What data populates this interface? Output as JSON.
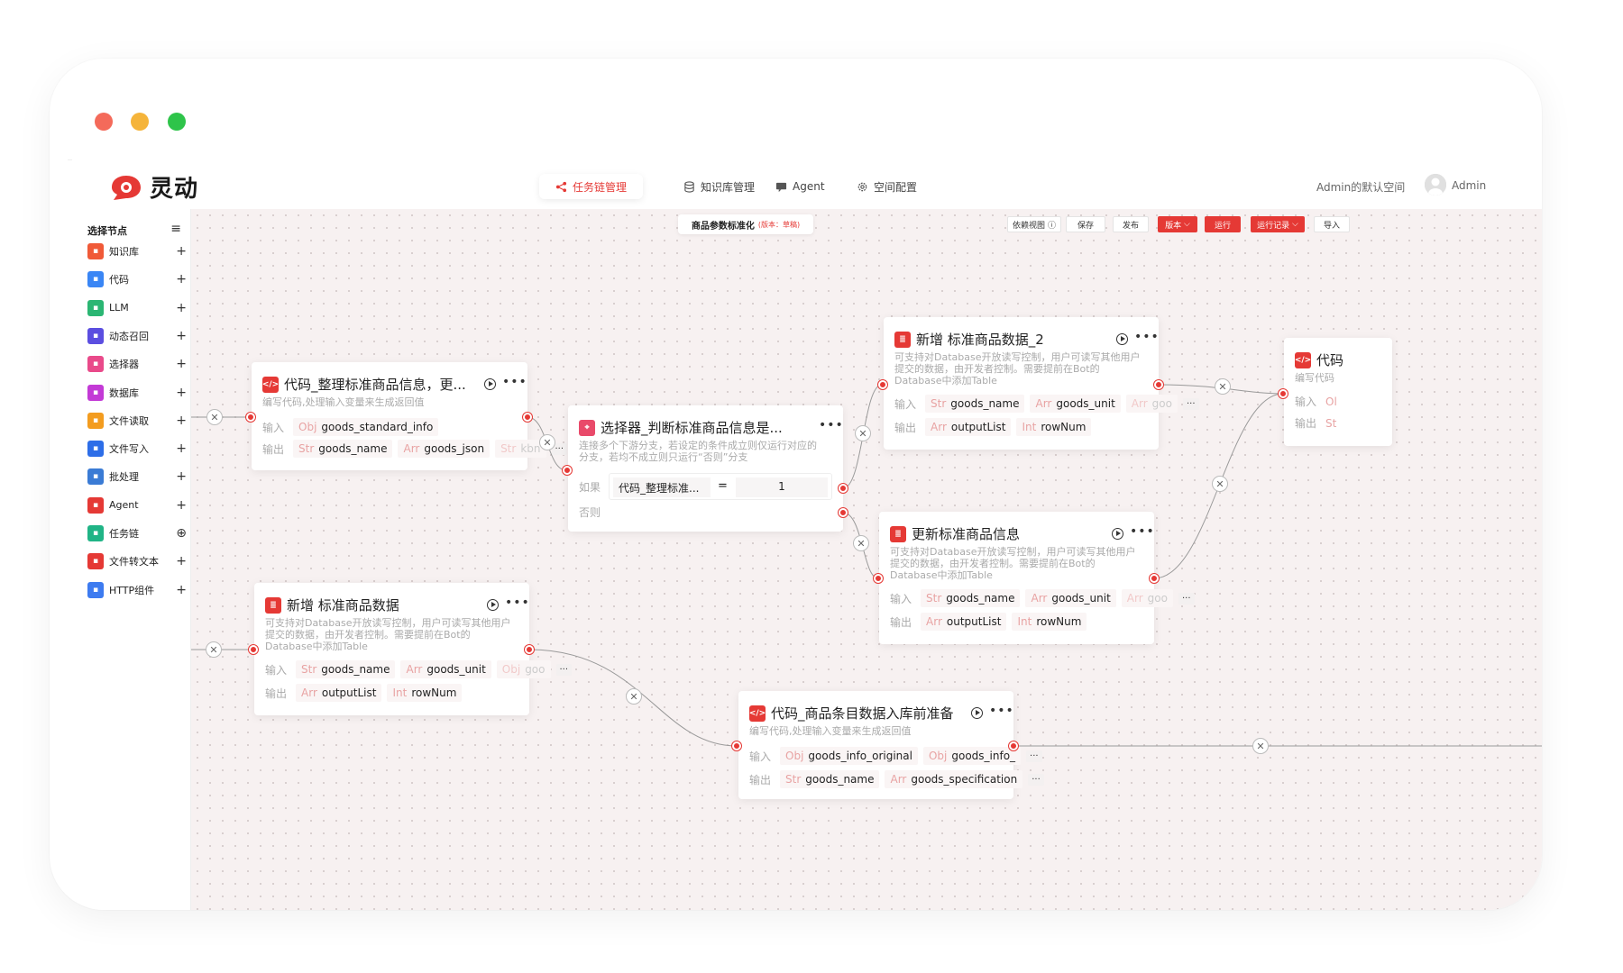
{
  "app": {
    "logo_text": "灵动",
    "nav": [
      {
        "label": "任务链管理",
        "active": true
      },
      {
        "label": "知识库管理",
        "active": false
      },
      {
        "label": "Agent",
        "active": false
      },
      {
        "label": "空间配置",
        "active": false
      }
    ],
    "workspace": "Admin的默认空间",
    "user": "Admin"
  },
  "sidebar": {
    "title": "选择节点",
    "items": [
      {
        "label": "知识库",
        "icon": "book-icon",
        "color": "#f05a38",
        "action": "+"
      },
      {
        "label": "代码",
        "icon": "code-icon",
        "color": "#3a86f5",
        "action": "+"
      },
      {
        "label": "LLM",
        "icon": "llm-icon",
        "color": "#2bb673",
        "action": "+"
      },
      {
        "label": "动态召回",
        "icon": "recall-icon",
        "color": "#5b4ee0",
        "action": "+"
      },
      {
        "label": "选择器",
        "icon": "selector-icon",
        "color": "#e94a8a",
        "action": "+"
      },
      {
        "label": "数据库",
        "icon": "database-icon",
        "color": "#c33ad6",
        "action": "+"
      },
      {
        "label": "文件读取",
        "icon": "file-read-icon",
        "color": "#f39c1f",
        "action": "+"
      },
      {
        "label": "文件写入",
        "icon": "file-write-icon",
        "color": "#2d6ee8",
        "action": "+"
      },
      {
        "label": "批处理",
        "icon": "batch-icon",
        "color": "#3a7bd5",
        "action": "+"
      },
      {
        "label": "Agent",
        "icon": "agent-icon",
        "color": "#e53935",
        "action": "+"
      },
      {
        "label": "任务链",
        "icon": "chain-icon",
        "color": "#20b486",
        "action": "⊕"
      },
      {
        "label": "文件转文本",
        "icon": "file-text-icon",
        "color": "#e53935",
        "action": "+"
      },
      {
        "label": "HTTP组件",
        "icon": "http-icon",
        "color": "#3d7bf0",
        "action": "+"
      }
    ]
  },
  "toolbar": {
    "flow_name": "商品参数标准化",
    "flow_version": "(版本：草稿)",
    "buttons": [
      "依赖视图",
      "保存",
      "发布",
      "版本",
      "运行",
      "运行记录",
      "导入"
    ]
  },
  "nodes": {
    "code1": {
      "title": "代码_整理标准商品信息，更...",
      "desc": [
        "编写代码,处理输入变量来生成返回值"
      ],
      "input_label": "输入",
      "inputs": [
        {
          "type": "Obj",
          "name": "goods_standard_info"
        }
      ],
      "output_label": "输出",
      "outputs": [
        {
          "type": "Str",
          "name": "goods_name"
        },
        {
          "type": "Arr",
          "name": "goods_json"
        },
        {
          "type": "Str",
          "name": "kbn"
        }
      ]
    },
    "selector": {
      "title": "选择器_判断标准商品信息是...",
      "desc": [
        "连接多个下游分支，若设定的条件成立则仅运行对应的",
        "分支，若均不成立则只运行“否则”分支"
      ],
      "if_label": "如果",
      "cond_left": "代码_整理标准...",
      "cond_op": "=",
      "cond_right": "1",
      "else_label": "否则"
    },
    "insert1": {
      "title": "新增 标准商品数据",
      "desc": [
        "可支持对Database开放读写控制，用户可读写其他用户",
        "提交的数据，由开发者控制。需要提前在Bot的",
        "Database中添加Table"
      ],
      "input_label": "输入",
      "inputs": [
        {
          "type": "Str",
          "name": "goods_name"
        },
        {
          "type": "Arr",
          "name": "goods_unit"
        },
        {
          "type": "Obj",
          "name": "goo"
        }
      ],
      "output_label": "输出",
      "outputs": [
        {
          "type": "Arr",
          "name": "outputList"
        },
        {
          "type": "Int",
          "name": "rowNum"
        }
      ]
    },
    "insert2": {
      "title": "新增 标准商品数据_2",
      "desc": [
        "可支持对Database开放读写控制，用户可读写其他用户",
        "提交的数据，由开发者控制。需要提前在Bot的",
        "Database中添加Table"
      ],
      "input_label": "输入",
      "inputs": [
        {
          "type": "Str",
          "name": "goods_name"
        },
        {
          "type": "Arr",
          "name": "goods_unit"
        },
        {
          "type": "Arr",
          "name": "goo"
        }
      ],
      "output_label": "输出",
      "outputs": [
        {
          "type": "Arr",
          "name": "outputList"
        },
        {
          "type": "Int",
          "name": "rowNum"
        }
      ]
    },
    "update": {
      "title": "更新标准商品信息",
      "desc": [
        "可支持对Database开放读写控制，用户可读写其他用户",
        "提交的数据，由开发者控制。需要提前在Bot的",
        "Database中添加Table"
      ],
      "input_label": "输入",
      "inputs": [
        {
          "type": "Str",
          "name": "goods_name"
        },
        {
          "type": "Arr",
          "name": "goods_unit"
        },
        {
          "type": "Arr",
          "name": "goo"
        }
      ],
      "output_label": "输出",
      "outputs": [
        {
          "type": "Arr",
          "name": "outputList"
        },
        {
          "type": "Int",
          "name": "rowNum"
        }
      ]
    },
    "code2": {
      "title": "代码_商品条目数据入库前准备",
      "desc": [
        "编写代码,处理输入变量来生成返回值"
      ],
      "input_label": "输入",
      "inputs": [
        {
          "type": "Obj",
          "name": "goods_info_original"
        },
        {
          "type": "Obj",
          "name": "goods_info_"
        }
      ],
      "output_label": "输出",
      "outputs": [
        {
          "type": "Str",
          "name": "goods_name"
        },
        {
          "type": "Arr",
          "name": "goods_specification"
        }
      ]
    },
    "code3": {
      "title": "代码",
      "desc": [
        "编写代码"
      ],
      "input_label": "输入",
      "inputs": [
        {
          "type": "Ol",
          "name": ""
        }
      ],
      "output_label": "输出",
      "outputs": [
        {
          "type": "St",
          "name": ""
        }
      ]
    }
  },
  "colors": {
    "accent": "#e53935",
    "canvas": "#f7f1f1"
  }
}
